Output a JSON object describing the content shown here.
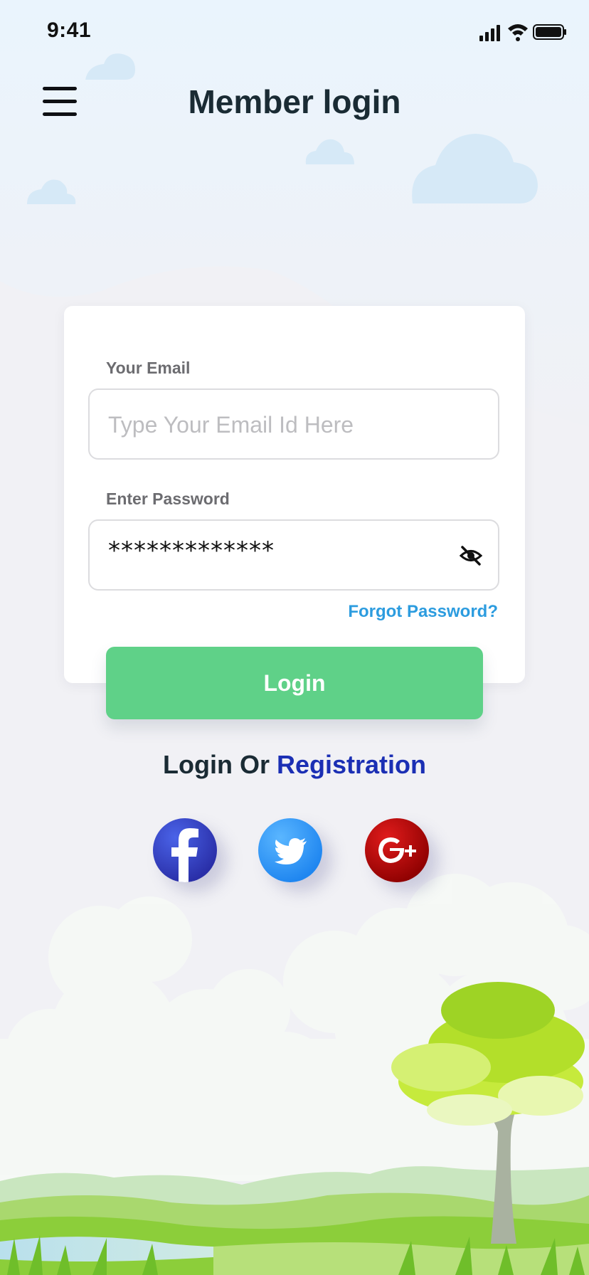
{
  "status_bar": {
    "time": "9:41"
  },
  "header": {
    "title": "Member login"
  },
  "form": {
    "email_label": "Your Email",
    "email_placeholder": "Type Your Email Id Here",
    "password_label": "Enter Password",
    "password_value": "*************",
    "forgot_link": "Forgot Password?",
    "login_button": "Login"
  },
  "alt_login": {
    "text": "Login Or",
    "registration_link": "Registration"
  },
  "social": [
    {
      "name": "facebook",
      "icon": "facebook-icon",
      "color": "#3b4fd8"
    },
    {
      "name": "twitter",
      "icon": "twitter-icon",
      "color": "#2b9cf5"
    },
    {
      "name": "google-plus",
      "icon": "google-plus-icon",
      "color": "#c40d0d"
    }
  ],
  "colors": {
    "accent_green": "#5fd188",
    "link_blue": "#2c9cdf",
    "registration_blue": "#1b2fb4",
    "title": "#1a2b34"
  }
}
